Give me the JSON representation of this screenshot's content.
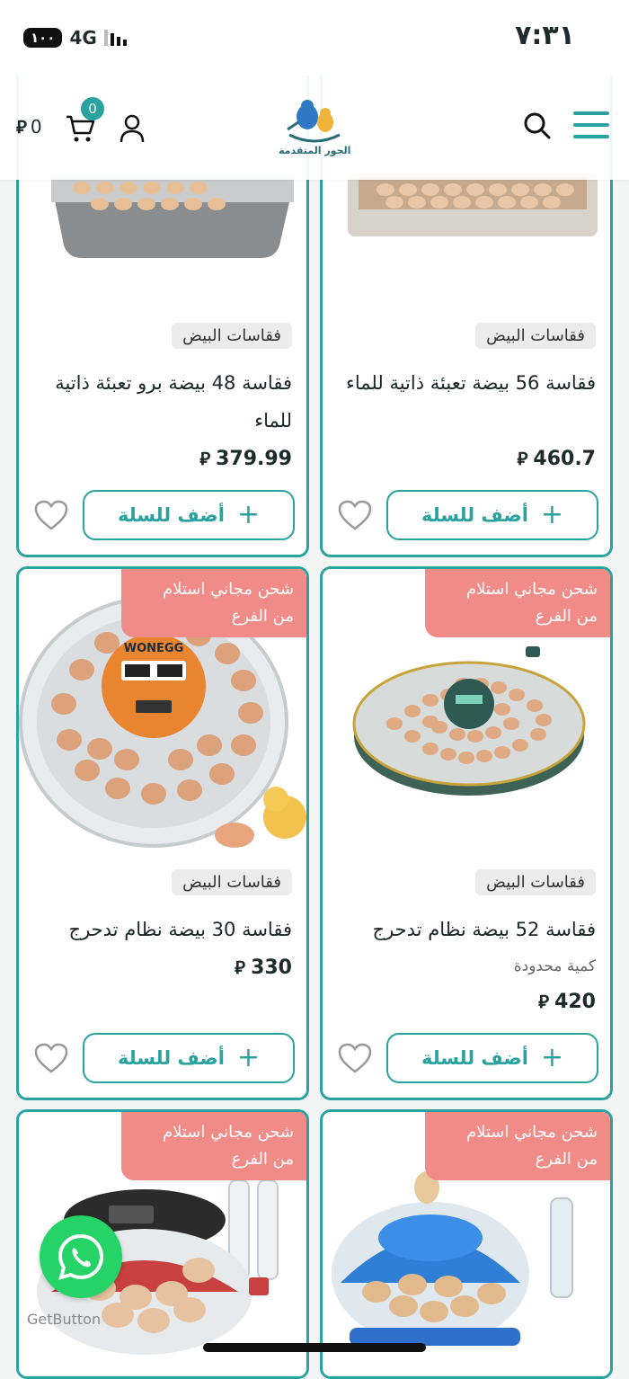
{
  "status_bar": {
    "time": "٧:٣١",
    "network": "4G",
    "battery": "١٠٠"
  },
  "header": {
    "logo_text": "الجور المتقدمة",
    "cart_count": "0",
    "cart_total": "0",
    "currency": "⃁",
    "icons": {
      "menu": "menu-icon",
      "search": "search-icon",
      "user": "user-icon",
      "cart": "cart-icon"
    }
  },
  "colors": {
    "accent": "#2aa29f",
    "ribbon": "#f08b88",
    "whatsapp": "#25d366"
  },
  "products": [
    {
      "category": "فقاسات البيض",
      "title": "فقاسة 56 بيضة تعبئة ذاتية للماء",
      "price": "460.7",
      "add_label": "أضف للسلة",
      "ribbon": ""
    },
    {
      "category": "فقاسات البيض",
      "title": "فقاسة 48 بيضة برو تعبئة ذاتية للماء",
      "price": "379.99",
      "add_label": "أضف للسلة",
      "ribbon": ""
    },
    {
      "category": "فقاسات البيض",
      "title": "فقاسة 52 بيضة نظام تدحرج",
      "note": "كمية محدودة",
      "price": "420",
      "add_label": "أضف للسلة",
      "ribbon_line1": "شحن مجاني استلام",
      "ribbon_line2": "من الفرع"
    },
    {
      "category": "فقاسات البيض",
      "title": "فقاسة 30 بيضة نظام تدحرج",
      "price": "330",
      "add_label": "أضف للسلة",
      "ribbon_line1": "شحن مجاني استلام",
      "ribbon_line2": "من الفرع",
      "image_text": "WONEGG"
    },
    {
      "ribbon_line1": "شحن مجاني استلام",
      "ribbon_line2": "من الفرع"
    },
    {
      "ribbon_line1": "شحن مجاني استلام",
      "ribbon_line2": "من الفرع"
    }
  ],
  "floating": {
    "getbutton": "GetButton"
  }
}
